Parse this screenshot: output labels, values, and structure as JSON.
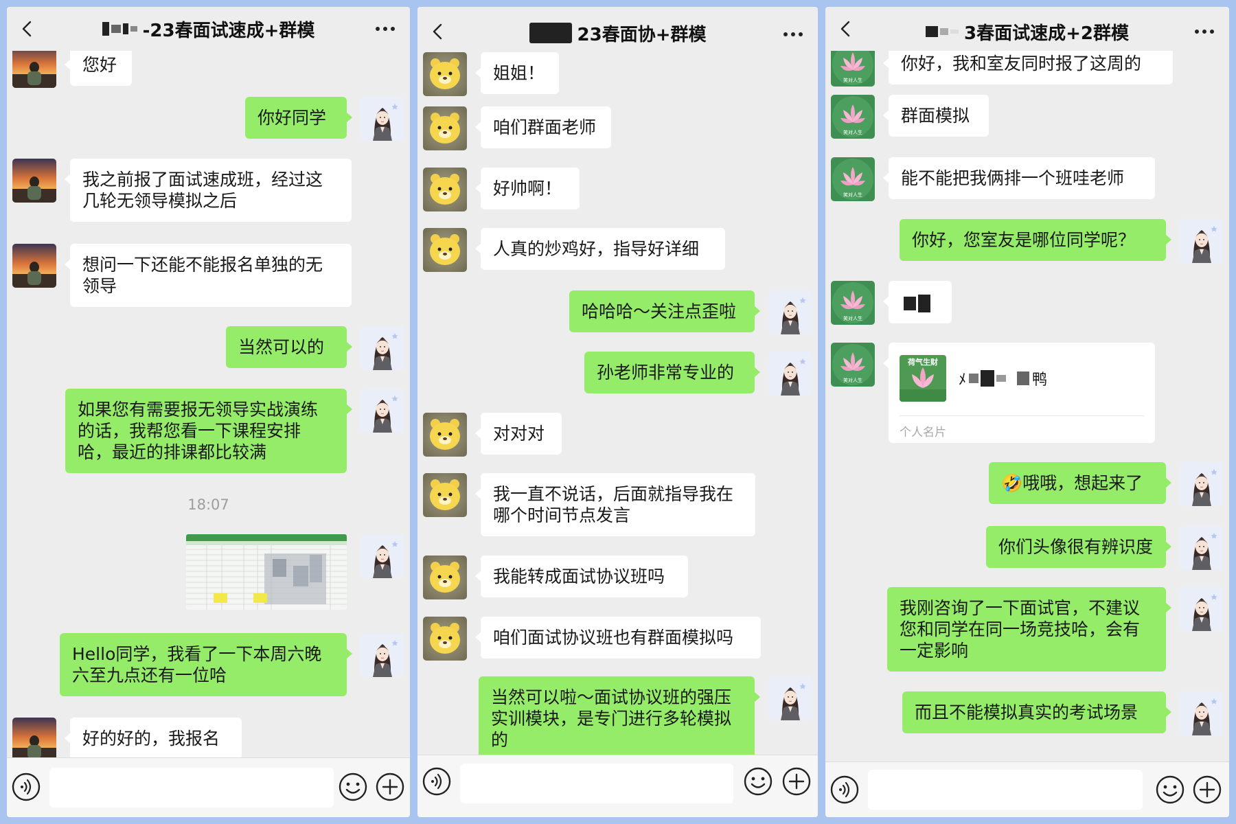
{
  "panels": [
    {
      "title": "-23春面试速成+群模",
      "footer_icons": [
        "voice-icon",
        "emoji-icon",
        "plus-icon"
      ],
      "messages": [
        {
          "side": "left",
          "avatar": "sunset-avatar",
          "text": "您好"
        },
        {
          "side": "right",
          "avatar": "girl-avatar",
          "text": "你好同学"
        },
        {
          "side": "left",
          "avatar": "sunset-avatar",
          "text": "我之前报了面试速成班，经过这几轮无领导模拟之后"
        },
        {
          "side": "left",
          "avatar": "sunset-avatar",
          "text": "想问一下还能不能报名单独的无领导"
        },
        {
          "side": "right",
          "avatar": "girl-avatar",
          "text": "当然可以的"
        },
        {
          "side": "right",
          "avatar": "girl-avatar",
          "text": "如果您有需要报无领导实战演练的话，我帮您看一下课程安排哈，最近的排课都比较满"
        },
        {
          "type": "timestamp",
          "text": "18:07"
        },
        {
          "side": "right",
          "avatar": "girl-avatar",
          "type": "image",
          "image": "schedule-table-thumbnail"
        },
        {
          "side": "right",
          "avatar": "girl-avatar",
          "text": "Hello同学，我看了一下本周六晚六至九点还有一位哈"
        },
        {
          "side": "left",
          "avatar": "sunset-avatar",
          "text": "好的好的，我报名"
        }
      ]
    },
    {
      "title": "23春面协+群模",
      "messages": [
        {
          "side": "left",
          "avatar": "bear-avatar",
          "text": "姐姐！"
        },
        {
          "side": "left",
          "avatar": "bear-avatar",
          "text": "咱们群面老师"
        },
        {
          "side": "left",
          "avatar": "bear-avatar",
          "text": "好帅啊！"
        },
        {
          "side": "left",
          "avatar": "bear-avatar",
          "text": "人真的炒鸡好，指导好详细"
        },
        {
          "side": "right",
          "avatar": "girl-avatar",
          "text": "哈哈哈～关注点歪啦"
        },
        {
          "side": "right",
          "avatar": "girl-avatar",
          "text": "孙老师非常专业的"
        },
        {
          "side": "left",
          "avatar": "bear-avatar",
          "text": "对对对"
        },
        {
          "side": "left",
          "avatar": "bear-avatar",
          "text": "我一直不说话，后面就指导我在哪个时间节点发言"
        },
        {
          "side": "left",
          "avatar": "bear-avatar",
          "text": "我能转成面试协议班吗"
        },
        {
          "side": "left",
          "avatar": "bear-avatar",
          "text": "咱们面试协议班也有群面模拟吗"
        },
        {
          "side": "right",
          "avatar": "girl-avatar",
          "text": "当然可以啦～面试协议班的强压实训模块，是专门进行多轮模拟的"
        }
      ]
    },
    {
      "title": "3春面试速成+2群模",
      "messages": [
        {
          "side": "left",
          "avatar": "lotus-avatar",
          "text": "你好，我和室友同时报了这周的"
        },
        {
          "side": "left",
          "avatar": "lotus-avatar",
          "text": "群面模拟"
        },
        {
          "side": "left",
          "avatar": "lotus-avatar",
          "text": "能不能把我俩排一个班哇老师"
        },
        {
          "side": "right",
          "avatar": "girl-avatar",
          "text": "你好，您室友是哪位同学呢？"
        },
        {
          "side": "left",
          "avatar": "lotus-avatar",
          "type": "redacted"
        },
        {
          "side": "left",
          "avatar": "lotus-avatar",
          "type": "contact-card",
          "card_thumb_label": "荷气生财",
          "card_name_start": "ﾒ",
          "card_name_end": "鸭",
          "card_label": "个人名片"
        },
        {
          "side": "right",
          "avatar": "girl-avatar",
          "text": "🤣哦哦，想起来了"
        },
        {
          "side": "right",
          "avatar": "girl-avatar",
          "text": "你们头像很有辨识度"
        },
        {
          "side": "right",
          "avatar": "girl-avatar",
          "text": "我刚咨询了一下面试官，不建议您和同学在同一场竞技哈，会有一定影响"
        },
        {
          "side": "right",
          "avatar": "girl-avatar",
          "text": "而且不能模拟真实的考试场景"
        }
      ]
    }
  ],
  "colors": {
    "background": "#a9c4ee",
    "panel": "#ededed",
    "bubble_self": "#95ec69",
    "bubble_other": "#ffffff",
    "timestamp": "#9d9d9d"
  }
}
